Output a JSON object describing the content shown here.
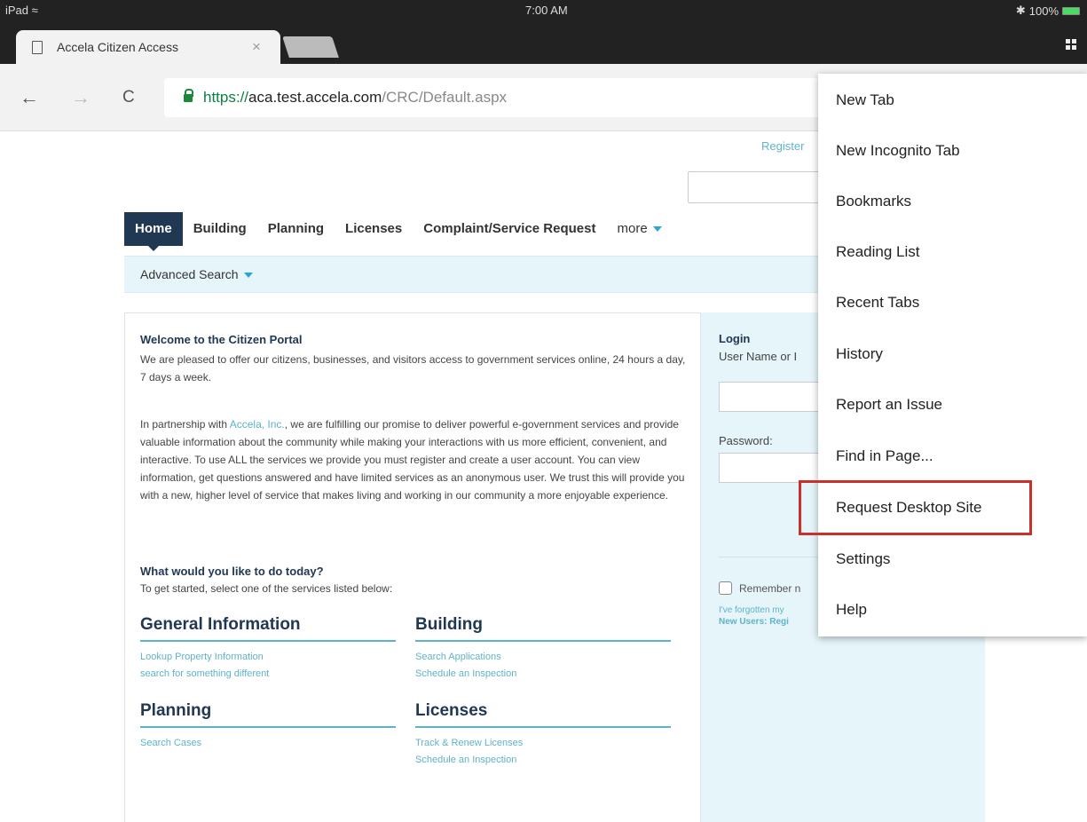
{
  "status_bar": {
    "device": "iPad",
    "wifi_icon": "wifi-icon",
    "time": "7:00 AM",
    "bluetooth": "✱",
    "battery_percent": "100%"
  },
  "browser": {
    "tab_title": "Accela Citizen Access",
    "tab_close": "×",
    "back": "←",
    "forward": "→",
    "reload": "C",
    "url_scheme": "https://",
    "url_host": "aca.test.accela.com",
    "url_path": "/CRC/Default.aspx"
  },
  "page": {
    "register_link": "Register",
    "nav": [
      "Home",
      "Building",
      "Planning",
      "Licenses",
      "Complaint/Service Request",
      "more"
    ],
    "subnav": "Advanced Search",
    "welcome_title": "Welcome to the Citizen Portal",
    "welcome_text": "We are pleased to offer our citizens, businesses, and visitors access to government services online, 24 hours a day, 7 days a week.",
    "partner_prefix": "In partnership with ",
    "partner_link": "Accela, Inc.",
    "partner_suffix": ", we are fulfilling our promise to deliver powerful e-government services and provide valuable information about the community while making your interactions with us more efficient, convenient, and interactive. To use ALL the services we provide you must register and create a user account. You can view information, get questions answered and have limited services as an anonymous user. We trust this will provide you with a new, higher level of service that makes living and working in our community a more enjoyable experience.",
    "todo_title": "What would you like to do today?",
    "todo_sub": "To get started, select one of the services listed below:",
    "sections": [
      {
        "title": "General Information",
        "links": [
          "Lookup Property Information",
          "search for something different"
        ]
      },
      {
        "title": "Building",
        "links": [
          "Search Applications",
          "Schedule an Inspection"
        ]
      },
      {
        "title": "Planning",
        "links": [
          "Search Cases"
        ]
      },
      {
        "title": "Licenses",
        "links": [
          "Track & Renew Licenses",
          "Schedule an Inspection"
        ]
      }
    ],
    "login": {
      "title": "Login",
      "username_label": "User Name or I",
      "password_label": "Password:",
      "remember": "Remember n",
      "forgot": "I've forgotten my",
      "new_users": "New Users: Regi"
    }
  },
  "menu": {
    "items": [
      "New Tab",
      "New Incognito Tab",
      "Bookmarks",
      "Reading List",
      "Recent Tabs",
      "History",
      "Report an Issue",
      "Find in Page...",
      "Request Desktop Site",
      "Settings",
      "Help"
    ],
    "highlighted_item": "Request Desktop Site",
    "highlight_color": "#c9302c"
  },
  "colors": {
    "nav_active": "#213853",
    "link": "#5fb3c7",
    "sidebar_bg": "#e6f5fa",
    "secure_green": "#0b8043"
  }
}
